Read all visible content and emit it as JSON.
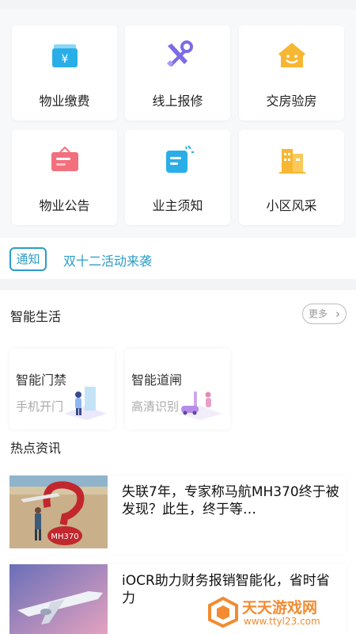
{
  "services": [
    {
      "label": "物业缴费",
      "icon": "payment-icon"
    },
    {
      "label": "线上报修",
      "icon": "repair-tools-icon"
    },
    {
      "label": "交房验房",
      "icon": "house-icon"
    },
    {
      "label": "物业公告",
      "icon": "notice-board-icon"
    },
    {
      "label": "业主须知",
      "icon": "document-icon"
    },
    {
      "label": "小区风采",
      "icon": "buildings-icon"
    }
  ],
  "notice": {
    "tag": "通知",
    "text": "双十二活动来袭"
  },
  "smart_life": {
    "title": "智能生活",
    "more": "更多",
    "cards": [
      {
        "title": "智能门禁",
        "subtitle": "手机开门",
        "icon": "door-access-illustration"
      },
      {
        "title": "智能道闸",
        "subtitle": "高清识别",
        "icon": "gate-car-illustration"
      }
    ]
  },
  "hot_news": {
    "title": "热点资讯",
    "items": [
      {
        "title": "失联7年，专家称马航MH370终于被发现？此生，终于等…",
        "thumb": "mh370-sand-sculpture-image"
      },
      {
        "title": "iOCR助力财务报销智能化，省时省力",
        "thumb": "airplane-image"
      }
    ]
  },
  "watermark": {
    "brand": "天天游戏网",
    "url": "www.ttyl23.com"
  },
  "colors": {
    "accent": "#2a9dc8",
    "watermark": "#f28b31"
  }
}
